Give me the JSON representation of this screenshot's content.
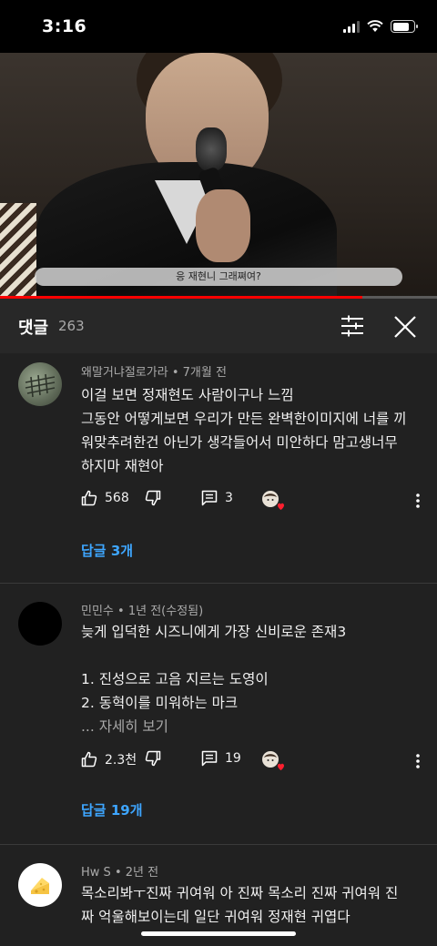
{
  "status_bar": {
    "time": "3:16"
  },
  "video": {
    "subtitle": "응 재현니 그래쪄여?",
    "progress": 0.83
  },
  "header": {
    "title": "댓글",
    "count": "263"
  },
  "comments": [
    {
      "author": "왜말거냐절로가라",
      "time": "7개월 전",
      "lines": [
        "이걸 보면 정재현도 사람이구나 느낌",
        "그동안 어떻게보면 우리가 만든 완벽한이미지에 너를 끼",
        "워맞추려한건 아닌가 생각들어서 미안하다 맘고생너무",
        "하지마 재현아"
      ],
      "likes": "568",
      "reply_count": "3",
      "replies_label": "답글 3개"
    },
    {
      "author": "민민수",
      "time": "1년 전(수정됨)",
      "lines": [
        "늦게 입덕한 시즈니에게 가장 신비로운 존재3",
        "",
        "1. 진성으로 고음 지르는 도영이",
        "2. 동혁이를 미워하는 마크"
      ],
      "more": "... 자세히 보기",
      "likes": "2.3천",
      "reply_count": "19",
      "replies_label": "답글 19개"
    },
    {
      "author": "Hw S",
      "time": "2년 전",
      "lines": [
        "목소리봐ㅜ진짜 귀여워 아 진짜 목소리 진짜 귀여워 진",
        "짜 억울해보이는데 일단 귀여워 정재현 귀엽다"
      ]
    }
  ],
  "separator": "•",
  "colors": {
    "accent_link": "#3ea6ff",
    "progress": "#ff0000",
    "background": "#212121"
  }
}
